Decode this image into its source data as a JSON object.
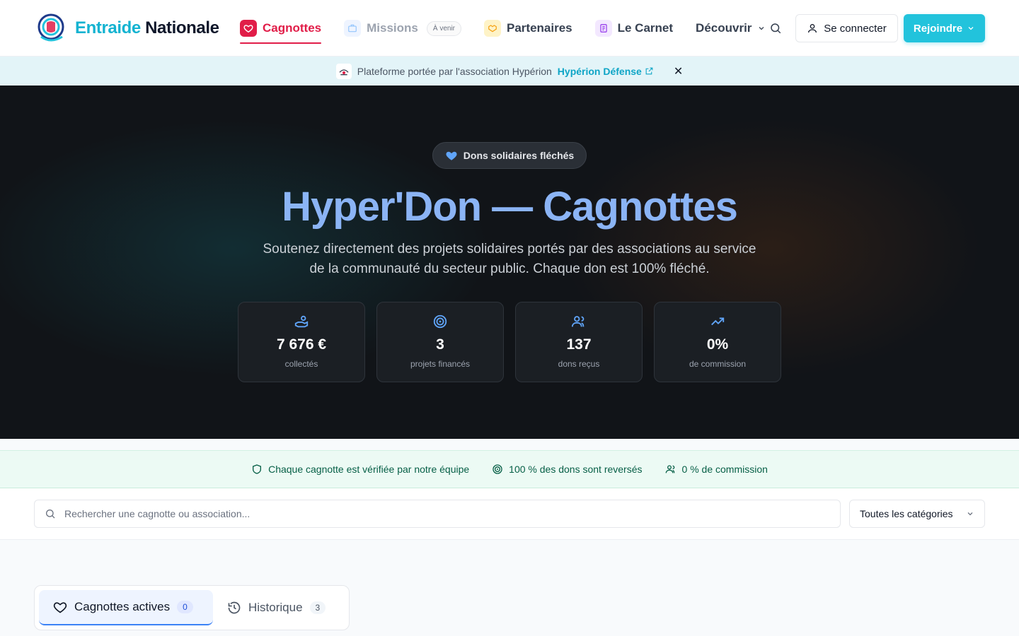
{
  "header": {
    "logo_part1": "Entraide",
    "logo_part2": "Nationale",
    "nav": {
      "cagnottes": "Cagnottes",
      "missions": "Missions",
      "missions_badge": "À venir",
      "partenaires": "Partenaires",
      "carnet": "Le Carnet",
      "decouvrir": "Découvrir"
    },
    "login_label": "Se connecter",
    "join_label": "Rejoindre"
  },
  "banner": {
    "text": "Plateforme portée par l'association Hypérion",
    "link": "Hypérion Défense"
  },
  "hero": {
    "pill": "Dons solidaires fléchés",
    "title": "Hyper'Don — Cagnottes",
    "subtitle": "Soutenez directement des projets solidaires portés par des associations au service de la communauté du secteur public. Chaque don est 100% fléché.",
    "stats": [
      {
        "icon": "hand-coins-icon",
        "value": "7 676 €",
        "label": "collectés"
      },
      {
        "icon": "target-icon",
        "value": "3",
        "label": "projets financés"
      },
      {
        "icon": "users-icon",
        "value": "137",
        "label": "dons reçus"
      },
      {
        "icon": "trending-up-icon",
        "value": "0%",
        "label": "de commission"
      }
    ]
  },
  "trust": {
    "verified": "Chaque cagnotte est vérifiée par notre équipe",
    "reversed": "100 % des dons sont reversés",
    "commission": "0 % de commission"
  },
  "filters": {
    "search_placeholder": "Rechercher une cagnotte ou association...",
    "category": "Toutes les catégories"
  },
  "tabs": {
    "active_label": "Cagnottes actives",
    "active_count": "0",
    "history_label": "Historique",
    "history_count": "3"
  },
  "colors": {
    "brand_cyan": "#22c3dc",
    "active_red": "#e11d48",
    "hero_title": "#8bb4f5",
    "trust_green": "#065f46"
  }
}
